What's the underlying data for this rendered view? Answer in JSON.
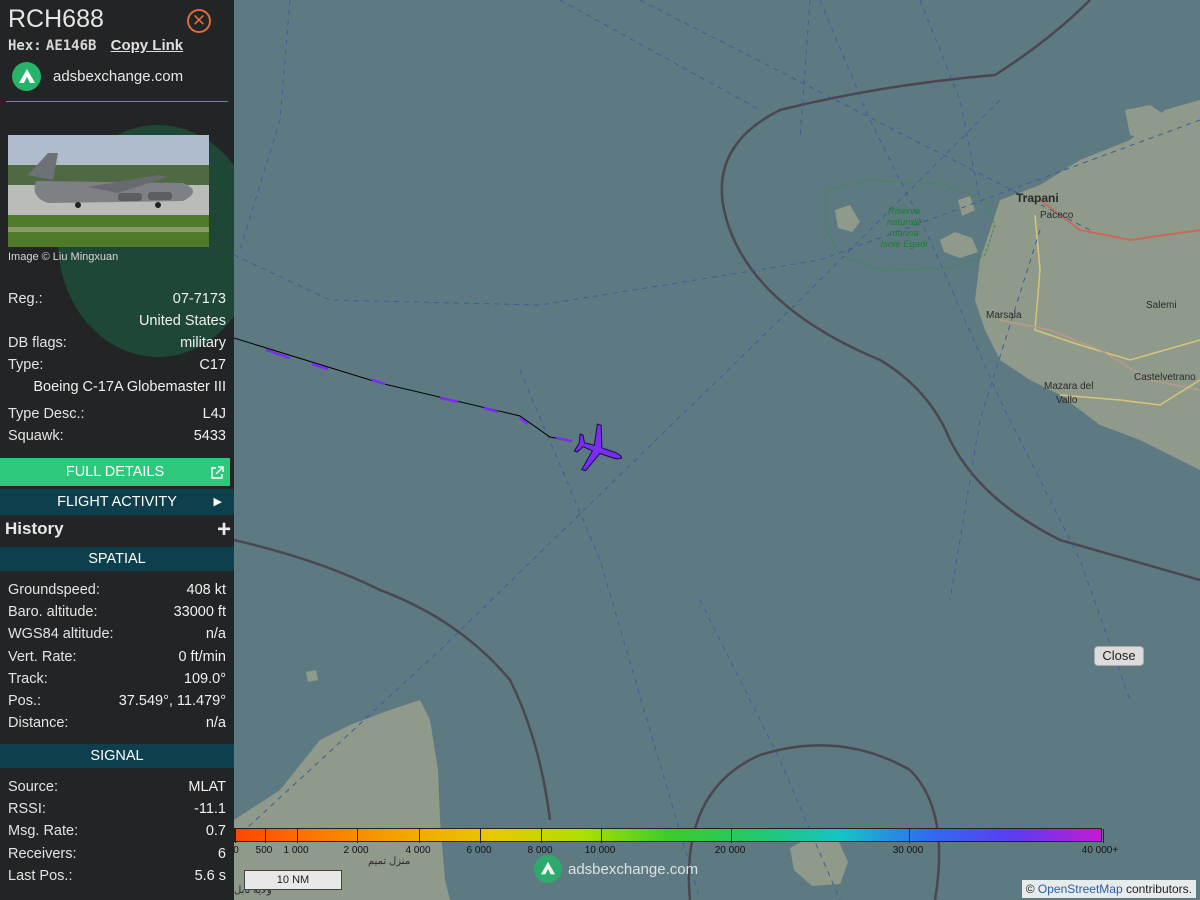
{
  "aircraft": {
    "callsign": "RCH688",
    "hex_label": "Hex:",
    "hex": "AE146B",
    "copy_link": "Copy Link",
    "brand": "adsbexchange.com",
    "image_credit": "Image © Liu Mingxuan"
  },
  "info": {
    "reg_label": "Reg.:",
    "reg": "07-7173",
    "country": "United States",
    "db_flags_label": "DB flags:",
    "db_flags": "military",
    "type_label": "Type:",
    "type": "C17",
    "type_full": "Boeing C-17A Globemaster III",
    "type_desc_label": "Type Desc.:",
    "type_desc": "L4J",
    "squawk_label": "Squawk:",
    "squawk": "5433"
  },
  "buttons": {
    "full_details": "FULL DETAILS",
    "full_details_icon": "external-link-icon",
    "flight_activity": "FLIGHT ACTIVITY",
    "history": "History",
    "history_toggle": "+"
  },
  "spatial": {
    "title": "SPATIAL",
    "rows": [
      {
        "label": "Groundspeed:",
        "value": "408 kt"
      },
      {
        "label": "Baro. altitude:",
        "value": "33000 ft"
      },
      {
        "label": "WGS84 altitude:",
        "value": "n/a"
      },
      {
        "label": "Vert. Rate:",
        "value": "0 ft/min"
      },
      {
        "label": "Track:",
        "value": "109.0°"
      },
      {
        "label": "Pos.:",
        "value": "37.549°, 11.479°"
      },
      {
        "label": "Distance:",
        "value": "n/a"
      }
    ]
  },
  "signal": {
    "title": "SIGNAL",
    "rows": [
      {
        "label": "Source:",
        "value": "MLAT"
      },
      {
        "label": "RSSI:",
        "value": "-11.1"
      },
      {
        "label": "Msg. Rate:",
        "value": "0.7"
      },
      {
        "label": "Receivers:",
        "value": "6"
      },
      {
        "label": "Last Pos.:",
        "value": "5.6 s"
      }
    ]
  },
  "map": {
    "close_button": "Close",
    "scale": "10 NM",
    "watermark": "adsbexchange.com",
    "attribution_prefix": "© ",
    "attribution_link": "OpenStreetMap",
    "attribution_suffix": " contributors.",
    "labels": {
      "trapani": "Trapani",
      "paceco": "Paceco",
      "salemi": "Salemi",
      "marsala": "Marsala",
      "mazara": "Mazara del",
      "vallo": "Vallo",
      "castelvetrano": "Castelvetrano",
      "reserve_1": "Riserva",
      "reserve_2": "naturale",
      "reserve_3": "marina",
      "reserve_4": "Isole Egadi",
      "arabic_1": "منزل تميم",
      "arabic_2": "ولاية نابل"
    },
    "colors": {
      "sea": "#5d7a82",
      "land": "#8d978a",
      "aircraft": "#7a2cf0",
      "track_line": "#000000"
    }
  },
  "altitude_legend": {
    "labels": [
      "0",
      "500",
      "1 000",
      "2 000",
      "4 000",
      "6 000",
      "8 000",
      "10 000",
      "20 000",
      "30 000",
      "40 000+"
    ],
    "gradient": [
      "#ff4500",
      "#ff7a00",
      "#f2a700",
      "#e8c800",
      "#aee000",
      "#3ccc2a",
      "#22c86a",
      "#16c4c6",
      "#2f6cf0",
      "#5b3cf0",
      "#c41ad4"
    ]
  }
}
